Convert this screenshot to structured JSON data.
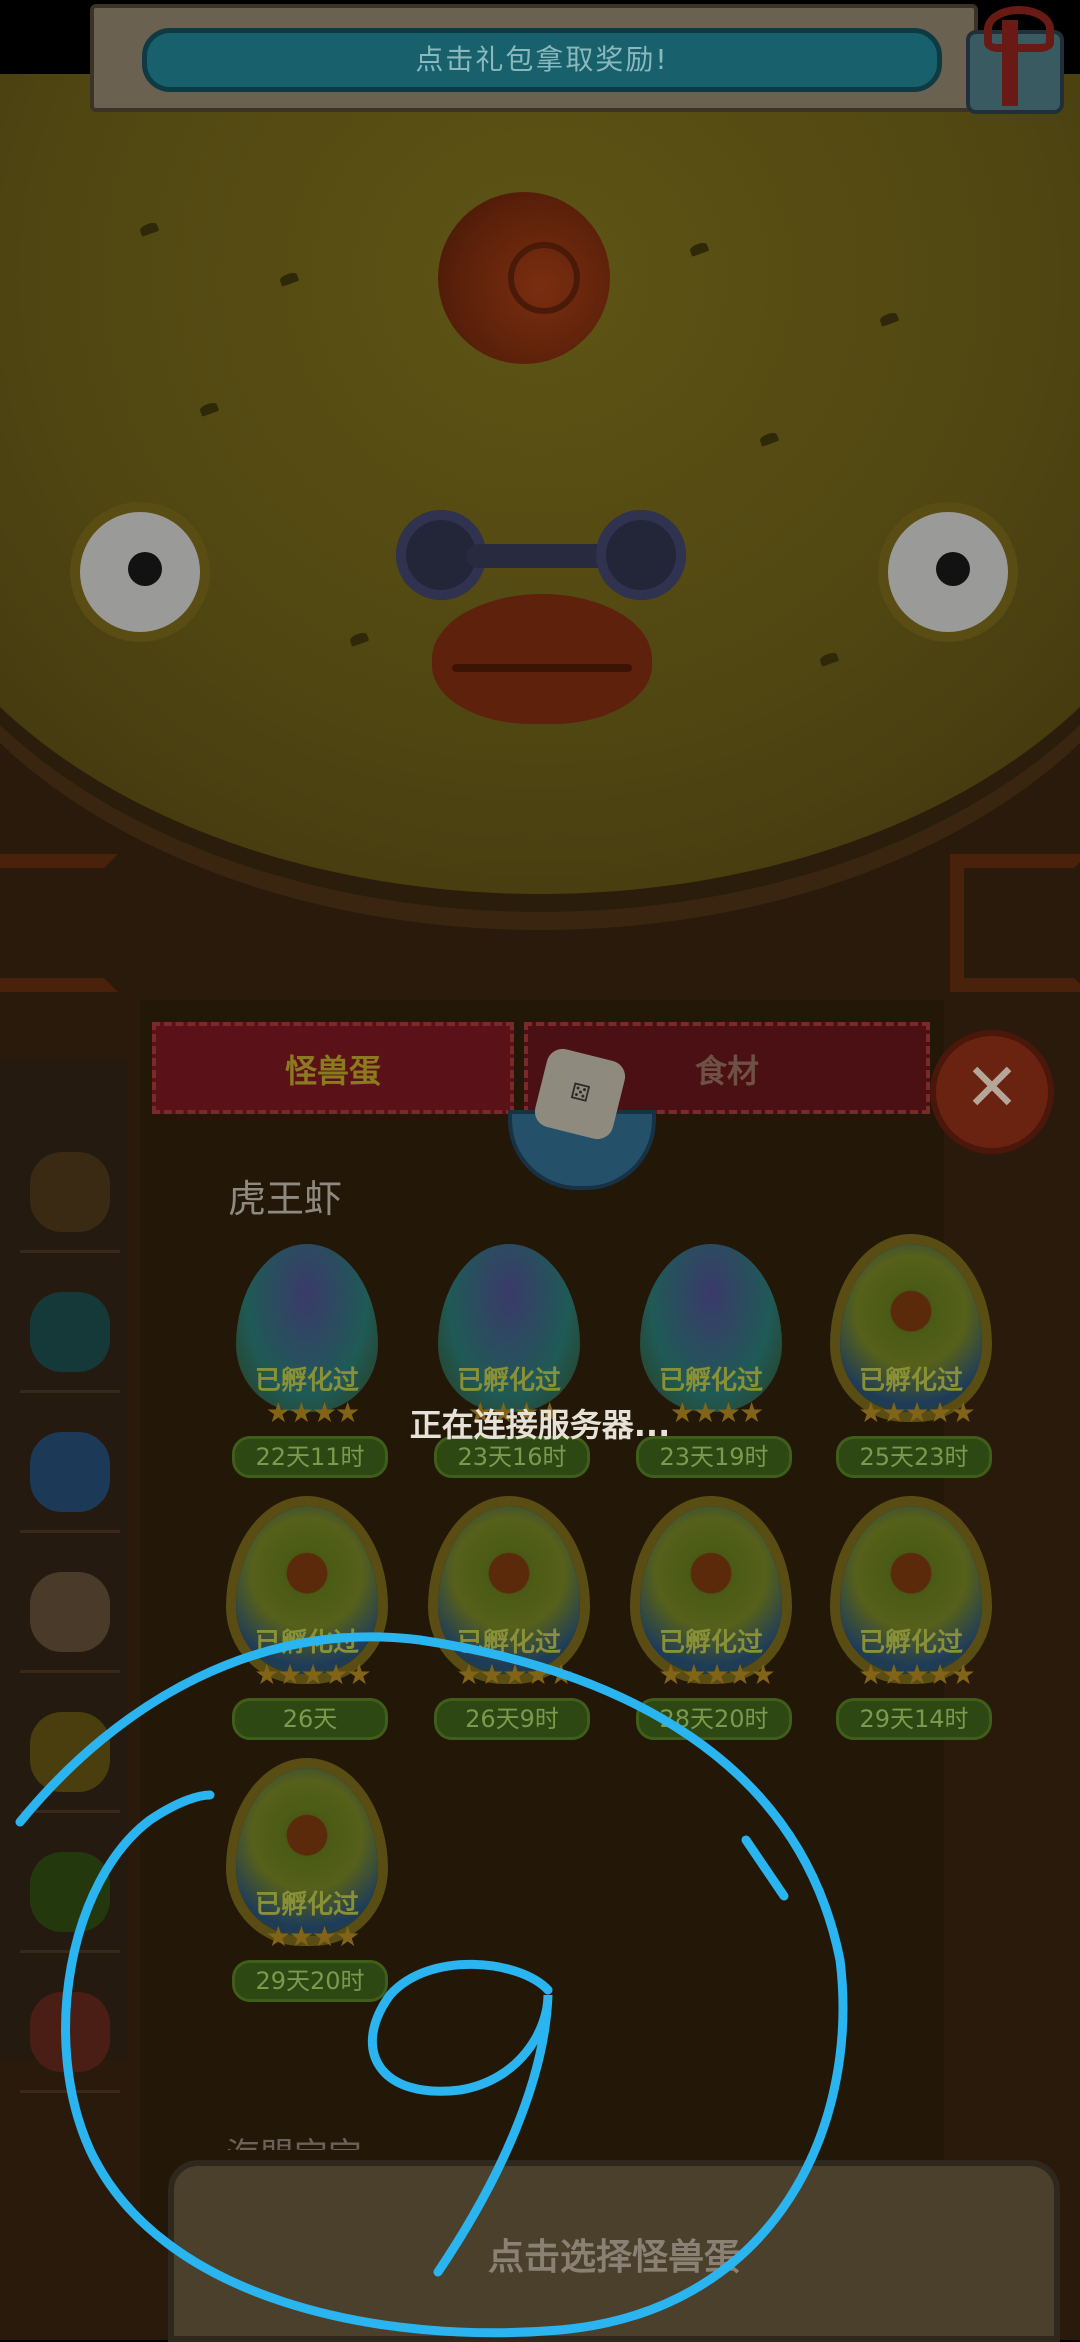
{
  "banner": {
    "text": "点击礼包拿取奖励!"
  },
  "tabs": [
    {
      "label": "怪兽蛋",
      "active": true
    },
    {
      "label": "食材",
      "active": false
    }
  ],
  "section": {
    "title": "虎王虾"
  },
  "loading_text": "正在连接服务器...",
  "eggs": [
    {
      "type": "purple",
      "status": "已孵化过",
      "stars": 4,
      "time": "22天11时"
    },
    {
      "type": "purple",
      "status": "已孵化过",
      "stars": 4,
      "time": "23天16时"
    },
    {
      "type": "purple",
      "status": "已孵化过",
      "stars": 4,
      "time": "23天19时"
    },
    {
      "type": "eye",
      "status": "已孵化过",
      "stars": 5,
      "time": "25天23时"
    },
    {
      "type": "eye",
      "status": "已孵化过",
      "stars": 5,
      "time": "26天"
    },
    {
      "type": "eye",
      "status": "已孵化过",
      "stars": 5,
      "time": "26天9时"
    },
    {
      "type": "eye",
      "status": "已孵化过",
      "stars": 5,
      "time": "28天20时"
    },
    {
      "type": "eye",
      "status": "已孵化过",
      "stars": 5,
      "time": "29天14时"
    },
    {
      "type": "eye",
      "status": "已孵化过",
      "stars": 4,
      "time": "29天20时"
    }
  ],
  "bottom_button": {
    "label": "点击选择怪兽蛋"
  },
  "next_section_partial": "海盟宝宝",
  "sidebar": [
    {
      "name": "tiger-shrimp-icon"
    },
    {
      "name": "sea-urchin-icon"
    },
    {
      "name": "crab-icon"
    },
    {
      "name": "walrus-icon"
    },
    {
      "name": "banana-creature-icon"
    },
    {
      "name": "crocodile-icon"
    },
    {
      "name": "parrot-icon"
    }
  ],
  "colors": {
    "ink_overlay": "#2ab4f0",
    "accent_green": "#4e8a1a",
    "tab_red": "#5a1218"
  }
}
